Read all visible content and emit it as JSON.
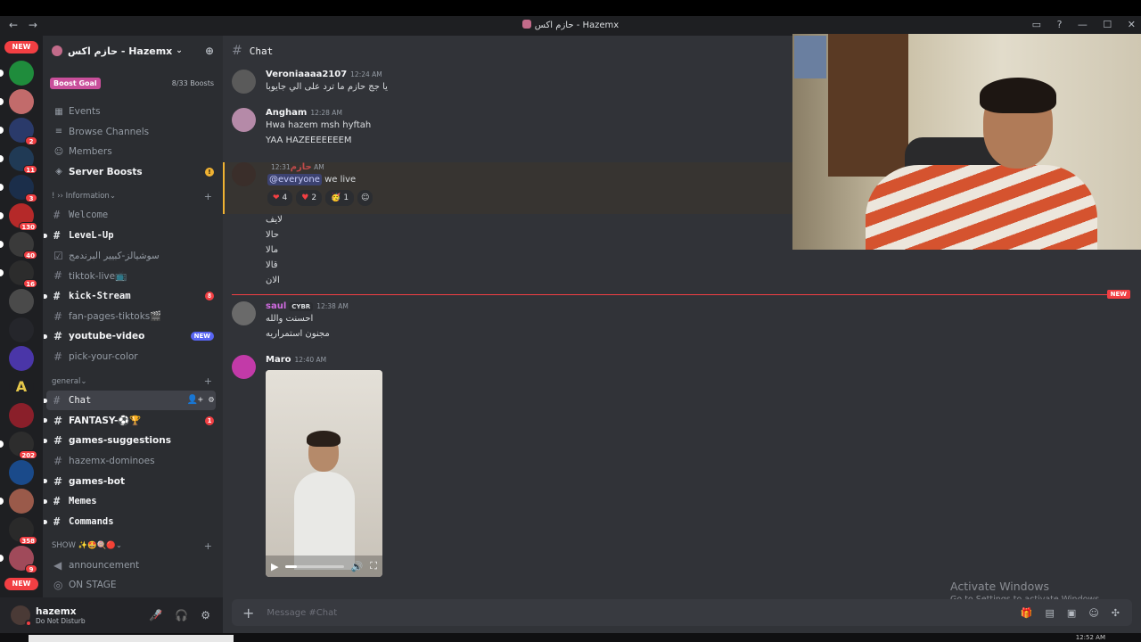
{
  "window": {
    "title": "حازم اكس - Hazemx",
    "nav_back": "←",
    "nav_forward": "→"
  },
  "rail": {
    "new_label": "NEW",
    "badges": [
      "2",
      "11",
      "3",
      "130",
      "40",
      "16",
      "202",
      "358",
      "9"
    ],
    "a_server": "A"
  },
  "server": {
    "name": "حازم اكس - Hazemx",
    "boost_goal": "Boost Goal",
    "boost_count": "8/33 Boosts"
  },
  "sidebar": {
    "misc": [
      {
        "label": "Events",
        "icon": "calendar-icon"
      },
      {
        "label": "Browse Channels",
        "icon": "browse-icon"
      },
      {
        "label": "Members",
        "icon": "members-icon"
      },
      {
        "label": "Server Boosts",
        "icon": "boost-icon"
      }
    ],
    "categories": {
      "information": "! ›› Information",
      "general": "general",
      "show": "SHOW ✨🤩🍭🔴"
    },
    "info_channels": [
      {
        "name": "Welcome",
        "mono": true
      },
      {
        "name": "LeveL-Up",
        "mono": true,
        "unread": true
      },
      {
        "name": "سوشيالز-كبيير البرندمج"
      },
      {
        "name": "tiktok-live📺"
      },
      {
        "name": "kick-Stream",
        "mono": true,
        "unread": true,
        "badge": "8"
      },
      {
        "name": "fan-pages-tiktoks🎬"
      },
      {
        "name": "youtube-video",
        "unread": true,
        "new": "NEW"
      },
      {
        "name": "pick-your-color"
      }
    ],
    "general_channels": [
      {
        "name": "Chat",
        "mono": true,
        "active": true
      },
      {
        "name": "FANTASY-⚽🏆",
        "unread": true,
        "badge": "1"
      },
      {
        "name": "games-suggestions",
        "unread": true
      },
      {
        "name": "hazemx-dominoes"
      },
      {
        "name": "games-bot",
        "unread": true
      },
      {
        "name": "Memes",
        "mono": true,
        "unread": true
      },
      {
        "name": "Commands",
        "mono": true,
        "unread": true
      }
    ],
    "show_channels": [
      {
        "name": "announcement"
      },
      {
        "name": "ON STAGE"
      }
    ]
  },
  "user": {
    "name": "hazemx",
    "status": "Do Not Disturb"
  },
  "chat": {
    "channel": "Chat",
    "placeholder": "Message #Chat",
    "new_divider": "NEW",
    "messages": [
      {
        "author": "Veroniaaaa2107",
        "time": "12:24 AM",
        "lines": [
          "يا جج حازم ما ترد على الي جايوبا"
        ]
      },
      {
        "author": "Angham",
        "time": "12:28 AM",
        "lines": [
          "Hwa hazem msh hyftah",
          "YAA HAZEEEEEEEM"
        ]
      },
      {
        "author": "حازم",
        "time": "12:31 AM",
        "mention": "@everyone",
        "text": "we live",
        "reactions": [
          {
            "emoji": "❤",
            "count": "4"
          },
          {
            "emoji": "♥",
            "count": "2"
          },
          {
            "emoji": "🥳",
            "count": "1"
          }
        ],
        "after": [
          "لايف",
          "حالا",
          "مالا",
          "قالا",
          "الان"
        ]
      },
      {
        "author": "saul",
        "role": "CYBR",
        "time": "12:38 AM",
        "lines": [
          "احسنت والله",
          "مجنون استمراريه"
        ]
      },
      {
        "author": "Maro",
        "time": "12:40 AM"
      }
    ]
  },
  "overlay": {
    "activate_title": "Activate Windows",
    "activate_sub": "Go to Settings to activate Windows."
  },
  "taskbar": {
    "clock": "12:52 AM"
  },
  "colors": {
    "accent": "#5865f2",
    "danger": "#f23f43",
    "warning": "#f0b232",
    "mention_bg": "#373431"
  }
}
